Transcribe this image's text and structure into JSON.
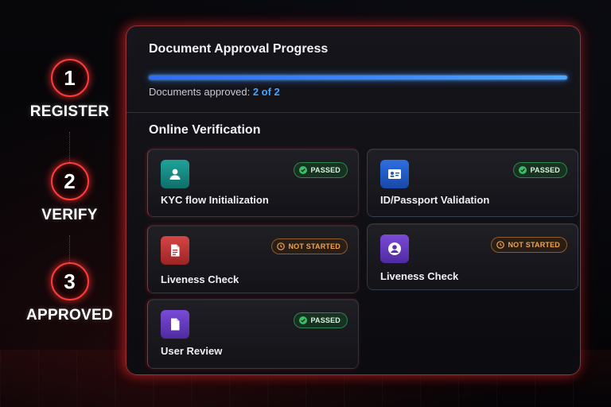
{
  "stepper": {
    "steps": [
      {
        "number": "1",
        "label": "REGISTER"
      },
      {
        "number": "2",
        "label": "VERIFY"
      },
      {
        "number": "3",
        "label": "APPROVED"
      }
    ]
  },
  "progress": {
    "title": "Document Approval Progress",
    "status_label": "Documents approved:",
    "count": "2 of 2",
    "fraction": 1.0,
    "color": "#3a8bff"
  },
  "verification": {
    "title": "Online Verification",
    "cards": [
      {
        "title": "KYC flow Initialization",
        "status": "PASSED",
        "icon": "user-icon",
        "icon_color": "#1fa39a"
      },
      {
        "title": "ID/Passport Validation",
        "status": "PASSED",
        "icon": "id-card-icon",
        "icon_color": "#2d6fe0"
      },
      {
        "title": "Liveness Check",
        "status": "NOT STARTED",
        "icon": "document-icon",
        "icon_color": "#d64545"
      },
      {
        "title": "Liveness Check",
        "status": "NOT STARTED",
        "icon": "user-circle-icon",
        "icon_color": "#7a4bd8"
      },
      {
        "title": "User Review",
        "status": "PASSED",
        "icon": "file-icon",
        "icon_color": "#7a4bd8"
      }
    ]
  },
  "colors": {
    "accent_red": "#ff3b3b",
    "passed_green": "#3cbe64",
    "not_started_orange": "#f2a24a"
  }
}
